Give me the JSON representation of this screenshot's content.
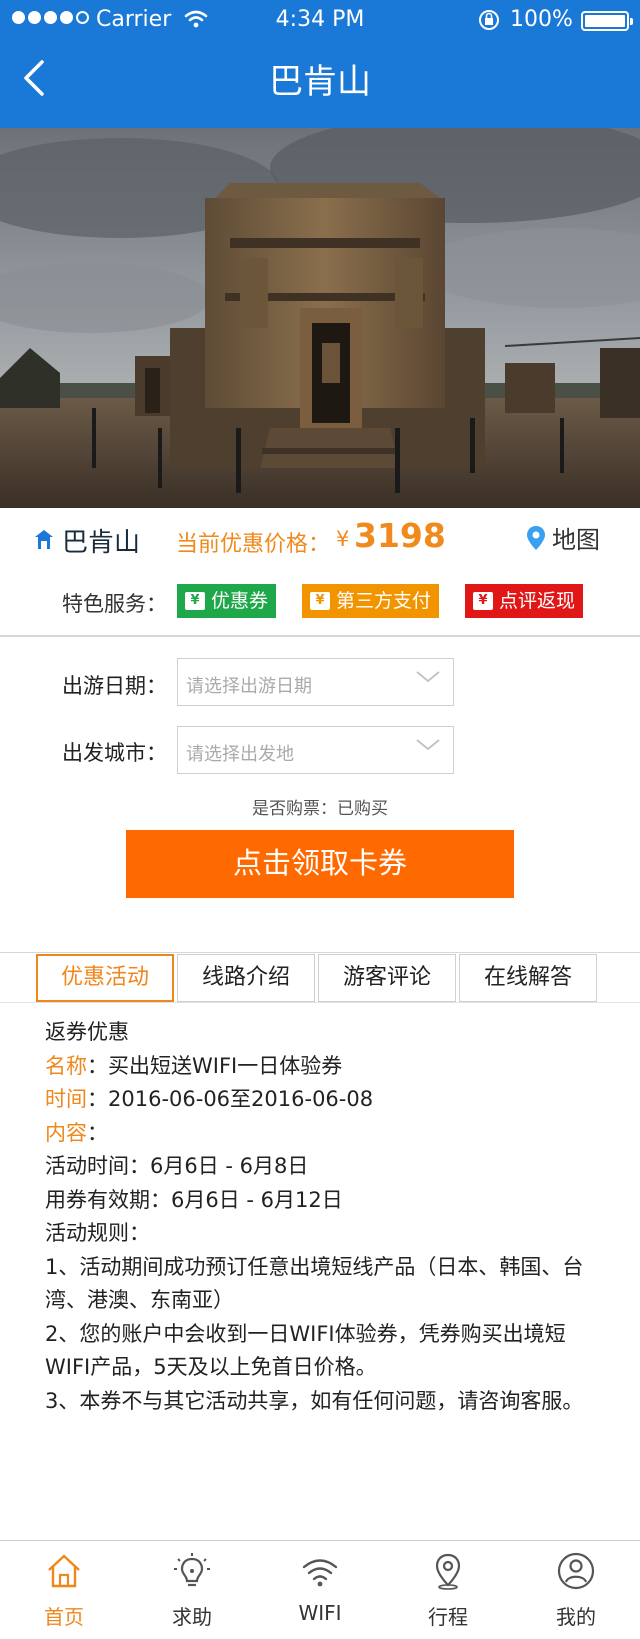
{
  "status_bar": {
    "carrier": "Carrier",
    "time": "4:34 PM",
    "battery": "100%"
  },
  "nav": {
    "title": "巴肯山"
  },
  "place": {
    "name": "巴肯山",
    "price_label": "当前优惠价格：",
    "currency": "¥",
    "price": "3198",
    "map_label": "地图"
  },
  "services": {
    "label": "特色服务：",
    "tags": [
      {
        "label": "优惠券",
        "color": "#1fa84a"
      },
      {
        "label": "第三方支付",
        "color": "#f29400"
      },
      {
        "label": "点评返现",
        "color": "#e11717"
      }
    ]
  },
  "form": {
    "date_label": "出游日期：",
    "date_placeholder": "请选择出游日期",
    "city_label": "出发城市：",
    "city_placeholder": "请选择出发地",
    "ticket_status": "是否购票：已购买",
    "cta_label": "点击领取卡券"
  },
  "tabs": [
    {
      "label": "优惠活动",
      "active": true
    },
    {
      "label": "线路介绍",
      "active": false
    },
    {
      "label": "游客评论",
      "active": false
    },
    {
      "label": "在线解答",
      "active": false
    }
  ],
  "promo": {
    "heading": "返券优惠",
    "name_key": "名称",
    "name_value": "：买出短送WIFI一日体验券",
    "time_key": "时间",
    "time_value": "：2016-06-06至2016-06-08",
    "content_key": "内容",
    "content_colon": "：",
    "lines": [
      "活动时间：6月6日 - 6月8日",
      "用券有效期：6月6日 - 6月12日",
      "活动规则：",
      "1、活动期间成功预订任意出境短线产品（日本、韩国、台湾、港澳、东南亚）",
      "2、您的账户中会收到一日WIFI体验券，凭券购买出境短WIFI产品，5天及以上免首日价格。",
      "3、本券不与其它活动共享，如有任何问题，请咨询客服。"
    ]
  },
  "tabbar": [
    {
      "label": "首页",
      "icon": "home-icon",
      "active": true
    },
    {
      "label": "求助",
      "icon": "lightbulb-icon",
      "active": false
    },
    {
      "label": "WIFI",
      "icon": "wifi-icon",
      "active": false
    },
    {
      "label": "行程",
      "icon": "location-pin-icon",
      "active": false
    },
    {
      "label": "我的",
      "icon": "user-icon",
      "active": false
    }
  ],
  "colors": {
    "brand_blue": "#1a78d6",
    "accent_orange": "#f0871c",
    "cta_orange": "#ff6a00"
  }
}
